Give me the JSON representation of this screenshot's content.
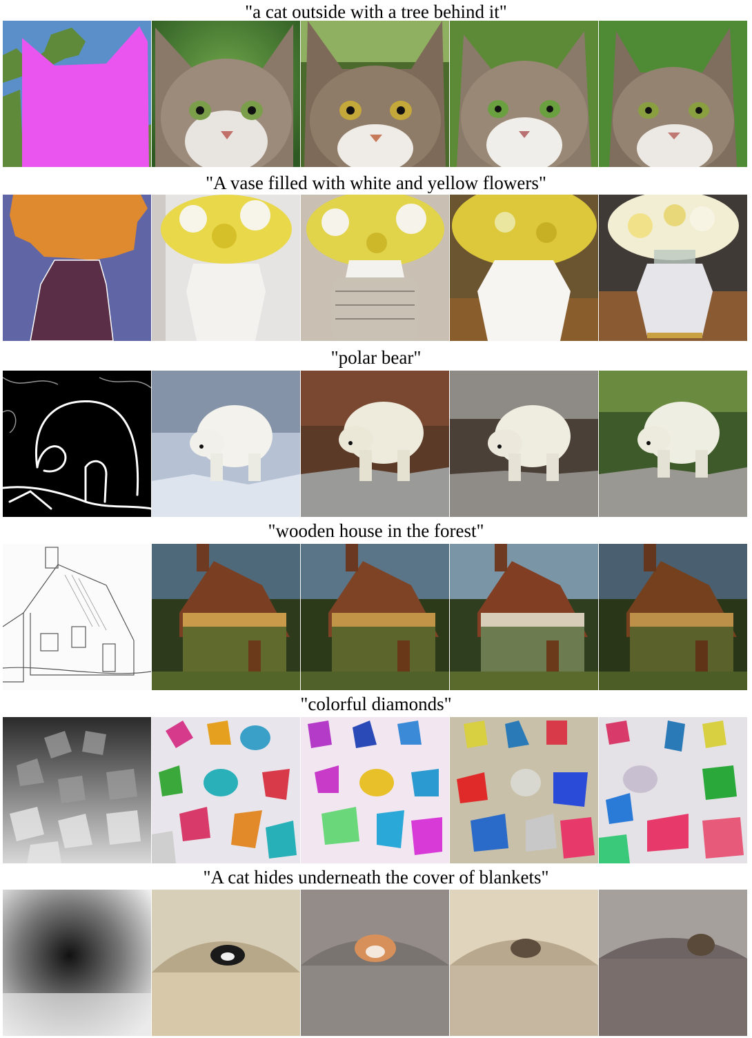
{
  "rows": [
    {
      "caption": "\"a cat outside with a tree behind it\"",
      "condition": "segmentation-map",
      "outputs": 4
    },
    {
      "caption": "\"A vase filled with white and yellow flowers\"",
      "condition": "segmentation-map",
      "outputs": 4
    },
    {
      "caption": "\"polar bear\"",
      "condition": "edge-map",
      "outputs": 4
    },
    {
      "caption": "\"wooden house in the forest\"",
      "condition": "sketch",
      "outputs": 4
    },
    {
      "caption": "\"colorful diamonds\"",
      "condition": "depth-map",
      "outputs": 4
    },
    {
      "caption": "\"A cat hides underneath the cover of blankets\"",
      "condition": "depth-map",
      "outputs": 4
    }
  ]
}
